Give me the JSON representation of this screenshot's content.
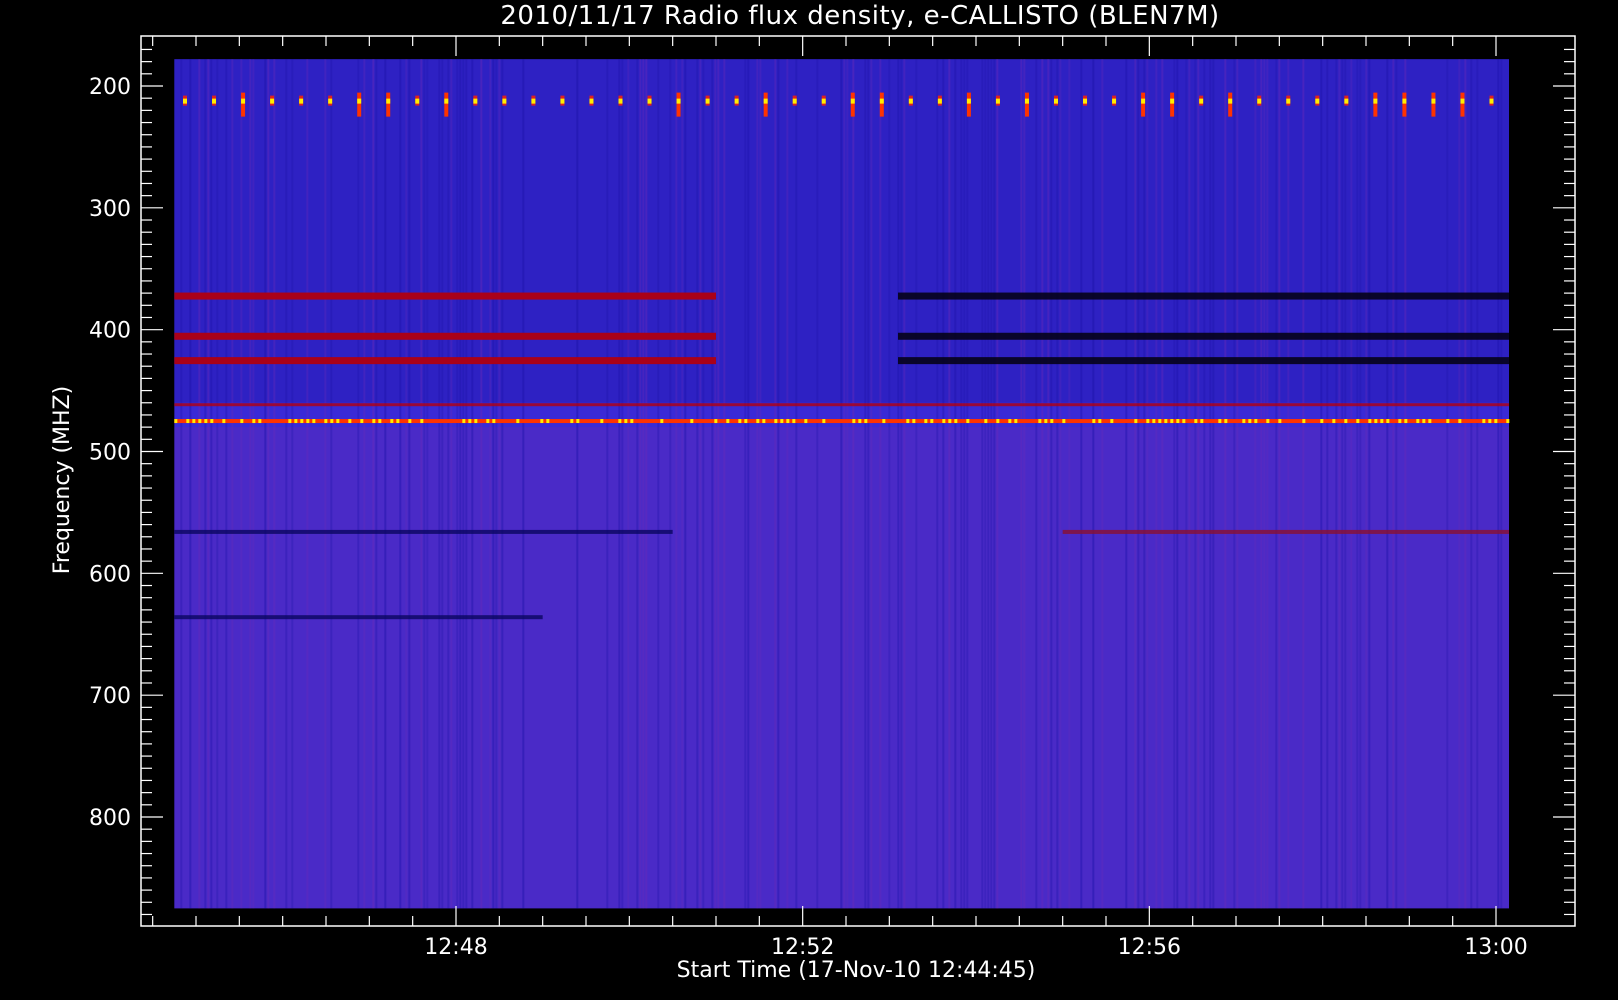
{
  "chart_data": {
    "type": "heatmap",
    "title": "2010/11/17  Radio flux density, e-CALLISTO (BLEN7M)",
    "xlabel": "Start Time (17-Nov-10 12:44:45)",
    "ylabel": "Frequency (MHZ)",
    "x_ticks": [
      "12:48",
      "12:52",
      "12:56",
      "13:00"
    ],
    "x_tick_minutes": [
      48,
      52,
      56,
      60
    ],
    "x_start_minute": 44.75,
    "x_end_minute": 60.15,
    "y_ticks": [
      200,
      300,
      400,
      500,
      600,
      700,
      800
    ],
    "ylim": [
      880,
      160
    ],
    "data_freq_range": [
      178,
      875
    ],
    "colors": {
      "background": "#000000",
      "base": "#3a2ad6",
      "base_dark": "#1a10a0",
      "hot": "#ff3300",
      "hotter": "#ffee00",
      "red_band": "#b00010"
    },
    "features": [
      {
        "kind": "periodic_bursts",
        "freq_mhz": 212,
        "note_color": "hot"
      },
      {
        "kind": "continuous_line_hot",
        "freq_mhz": 475
      },
      {
        "kind": "continuous_line_red",
        "freq_mhz": 462
      },
      {
        "kind": "band_red",
        "freq_mhz": [
          372,
          405,
          425
        ],
        "t_start": 44.75,
        "t_end": 51.0
      },
      {
        "kind": "band_dark",
        "freq_mhz": [
          372,
          405,
          425
        ],
        "t_start": 53.1,
        "t_end": 60.15
      },
      {
        "kind": "line_dark",
        "freq_mhz": 566,
        "t_start": 44.75,
        "t_end": 50.5
      },
      {
        "kind": "line_dark",
        "freq_mhz": 636,
        "t_start": 44.75,
        "t_end": 49.0
      },
      {
        "kind": "line_red",
        "freq_mhz": 566,
        "t_start": 55.0,
        "t_end": 60.15
      }
    ]
  }
}
